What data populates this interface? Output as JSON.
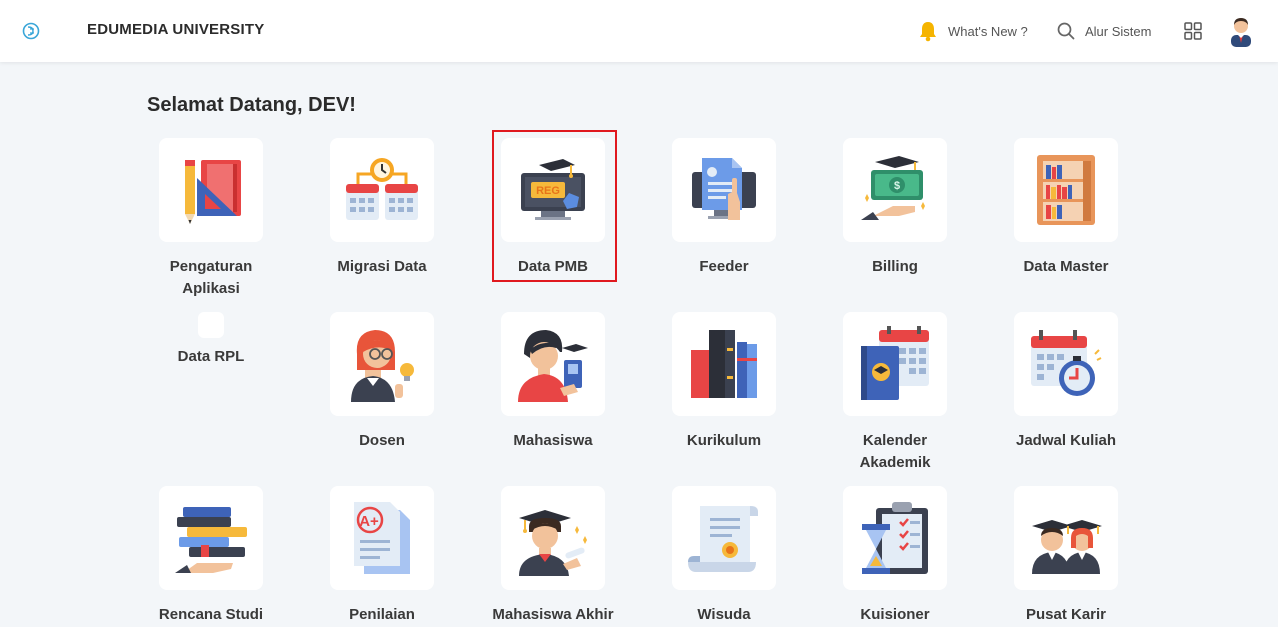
{
  "header": {
    "brand": "EDUMEDIA UNIVERSITY",
    "whats_new": "What's New ?",
    "search_label": "Alur Sistem"
  },
  "greeting": "Selamat Datang, DEV!",
  "selected_tile": "Data PMB",
  "tiles": [
    {
      "label": "Pengaturan Aplikasi",
      "icon": "settings-books-icon"
    },
    {
      "label": "Migrasi Data",
      "icon": "calendar-migrate-icon"
    },
    {
      "label": "Data PMB",
      "icon": "registration-monitor-icon",
      "badge": "REG"
    },
    {
      "label": "Feeder",
      "icon": "feeder-document-icon"
    },
    {
      "label": "Billing",
      "icon": "billing-money-icon"
    },
    {
      "label": "Data Master",
      "icon": "bookshelf-icon"
    },
    {
      "label": "Data RPL",
      "icon": "blank-icon"
    },
    {
      "label": "Dosen",
      "icon": "lecturer-icon"
    },
    {
      "label": "Mahasiswa",
      "icon": "student-icon"
    },
    {
      "label": "Kurikulum",
      "icon": "curriculum-books-icon"
    },
    {
      "label": "Kalender Akademik",
      "icon": "academic-calendar-icon"
    },
    {
      "label": "Jadwal Kuliah",
      "icon": "schedule-clock-icon"
    },
    {
      "label": "Rencana Studi",
      "icon": "study-plan-icon"
    },
    {
      "label": "Penilaian",
      "icon": "grade-paper-icon",
      "badge": "A+"
    },
    {
      "label": "Mahasiswa Akhir",
      "icon": "graduate-student-icon"
    },
    {
      "label": "Wisuda",
      "icon": "diploma-scroll-icon"
    },
    {
      "label": "Kuisioner",
      "icon": "questionnaire-icon"
    },
    {
      "label": "Pusat Karir",
      "icon": "career-center-icon"
    }
  ]
}
